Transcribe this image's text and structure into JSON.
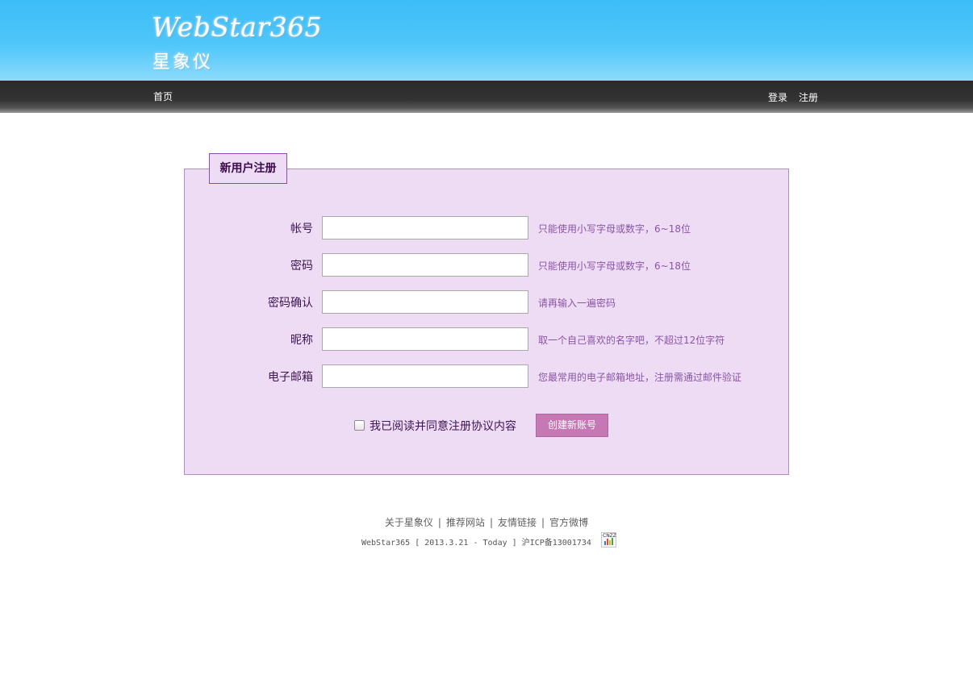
{
  "header": {
    "logo_en": "WebStar365",
    "logo_cn": "星象仪"
  },
  "nav": {
    "home": "首页",
    "login": "登录",
    "register": "注册"
  },
  "form": {
    "legend": "新用户注册",
    "fields": [
      {
        "label": "帐号",
        "value": "",
        "hint": "只能使用小写字母或数字，6~18位"
      },
      {
        "label": "密码",
        "value": "",
        "hint": "只能使用小写字母或数字，6~18位"
      },
      {
        "label": "密码确认",
        "value": "",
        "hint": "请再输入一遍密码"
      },
      {
        "label": "昵称",
        "value": "",
        "hint": "取一个自己喜欢的名字吧，不超过12位字符"
      },
      {
        "label": "电子邮箱",
        "value": "",
        "hint": "您最常用的电子邮箱地址，注册需通过邮件验证"
      }
    ],
    "agree_text": "我已阅读并同意注册协议内容",
    "agree_checked": false,
    "submit_label": "创建新账号"
  },
  "footer": {
    "links": [
      "关于星象仪",
      "推荐网站",
      "友情链接",
      "官方微博"
    ],
    "separator": "|",
    "copyright": "WebStar365 [ 2013.3.21 - Today ] 沪ICP备13001734",
    "stat_icon_text": "CNZZ",
    "stat_icon": "cnzz-stat-icon"
  },
  "colors": {
    "header_blue": "#3cbdf7",
    "navbar_dark": "#2a2a2a",
    "panel_bg": "#eddcf4",
    "panel_border": "#b48cc4",
    "hint_text": "#8a55a6",
    "button_bg": "#c678b4"
  }
}
